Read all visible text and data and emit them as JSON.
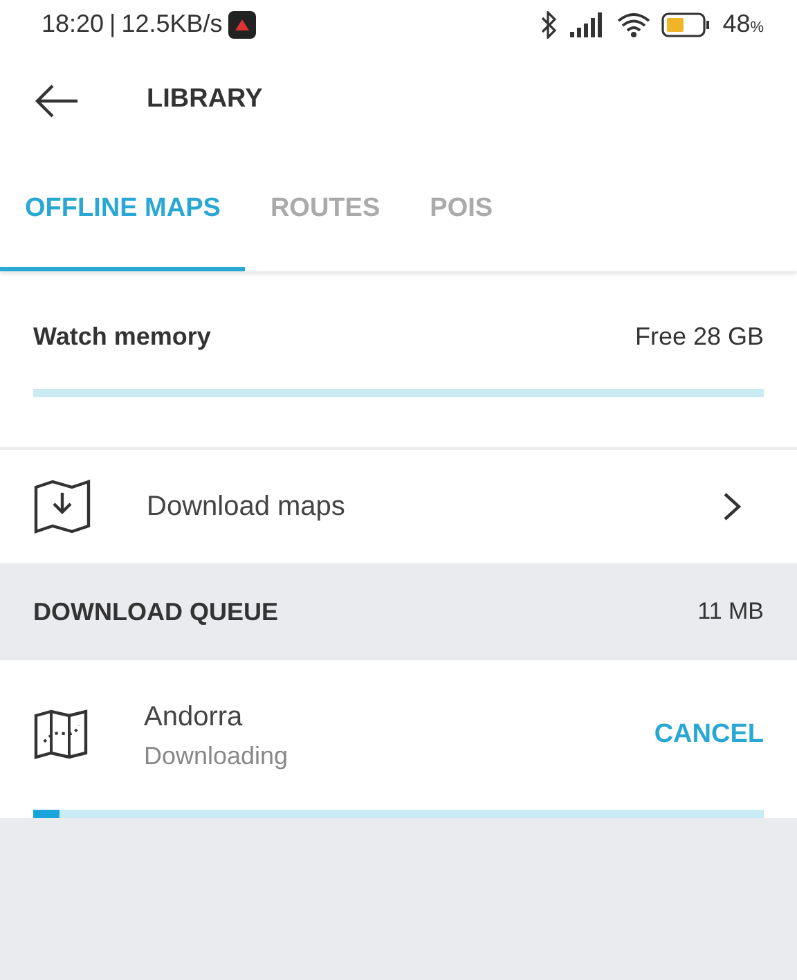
{
  "status_bar": {
    "time": "18:20",
    "separator": "|",
    "speed": "12.5KB/s",
    "battery": "48",
    "battery_unit": "%"
  },
  "header": {
    "title": "LIBRARY"
  },
  "tabs": [
    {
      "label": "OFFLINE MAPS",
      "selected": true
    },
    {
      "label": "ROUTES",
      "selected": false
    },
    {
      "label": "POIS",
      "selected": false
    }
  ],
  "memory": {
    "label": "Watch memory",
    "free": "Free 28 GB"
  },
  "download_maps": {
    "label": "Download maps"
  },
  "queue": {
    "title": "DOWNLOAD QUEUE",
    "size": "11 MB",
    "items": [
      {
        "name": "Andorra",
        "status": "Downloading",
        "action": "CANCEL",
        "level": 0.036
      }
    ]
  }
}
